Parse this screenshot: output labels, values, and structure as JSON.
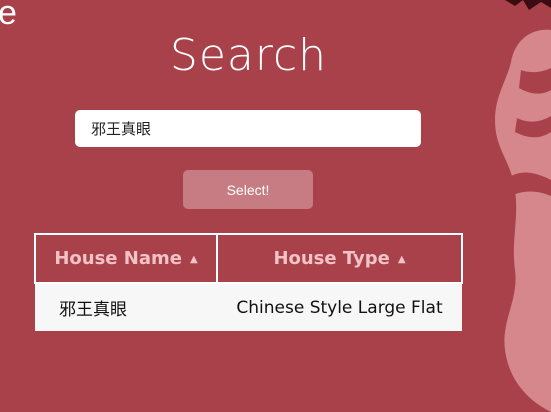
{
  "header": {
    "corner_fragment": "e",
    "title": "Search"
  },
  "search": {
    "value": "邪王真眼",
    "button_label": "Select!"
  },
  "table": {
    "columns": [
      {
        "label": "House Name",
        "sort_indicator": "▲"
      },
      {
        "label": "House Type",
        "sort_indicator": "▲"
      }
    ],
    "rows": [
      {
        "name": "邪王真眼",
        "type": "Chinese Style Large Flat"
      }
    ]
  },
  "colors": {
    "background": "#a8414a",
    "button": "#c67c82",
    "header_text": "#f2c3c6",
    "figure": "#d6878b"
  }
}
